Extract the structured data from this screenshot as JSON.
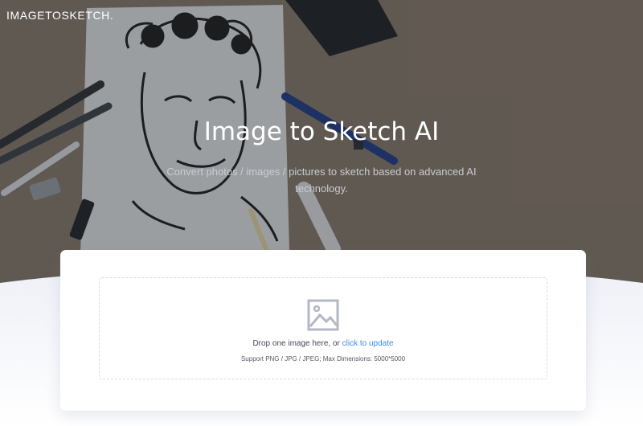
{
  "header": {
    "logo": "IMAGETOSKETCH."
  },
  "hero": {
    "title": "Image to Sketch AI",
    "subtitle": "Convert photos / images / pictures to sketch based on advanced AI technology."
  },
  "upload": {
    "drop_text": "Drop one image here, or",
    "drop_link": "click to update",
    "support_text": "Support PNG / JPG / JPEG; Max Dimensions: 5000*5000",
    "icon": "image-icon"
  },
  "colors": {
    "link": "#3c8ce0",
    "wave": "#eef0f7",
    "hero_overlay": "#2a2e35"
  }
}
